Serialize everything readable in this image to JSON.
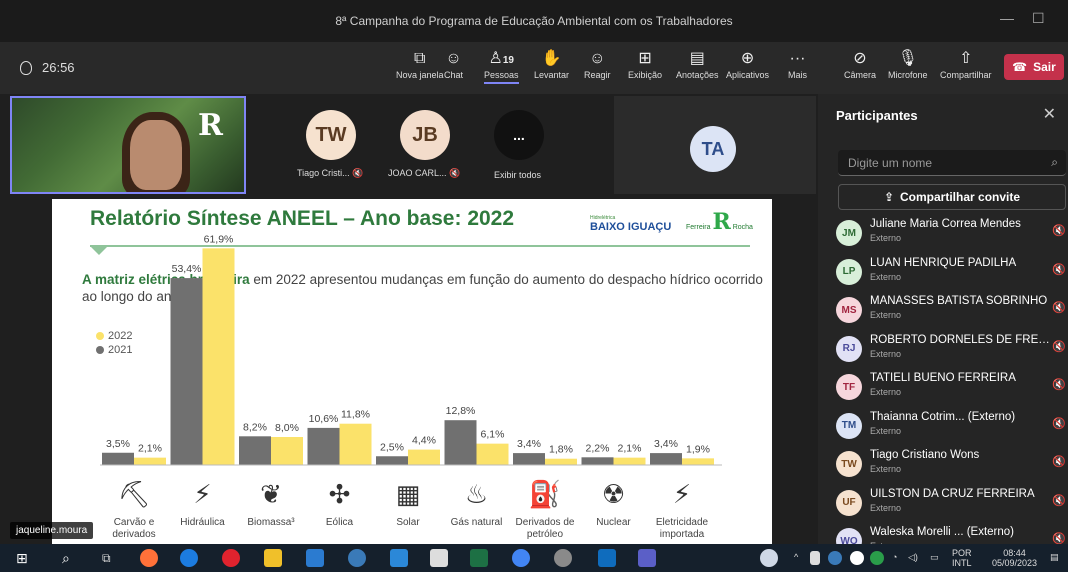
{
  "window": {
    "title": "8ª Campanha do Programa de Educação Ambiental com os Trabalhadores",
    "minimize": "—",
    "maximize": "☐"
  },
  "toolbar": {
    "timer": "26:56",
    "buttons": [
      {
        "label": "Nova janela",
        "icon": "new-window-icon"
      },
      {
        "label": "Chat",
        "icon": "chat-icon"
      },
      {
        "label": "Pessoas",
        "icon": "people-icon",
        "count": "19"
      },
      {
        "label": "Levantar",
        "icon": "raise-hand-icon"
      },
      {
        "label": "Reagir",
        "icon": "react-icon"
      },
      {
        "label": "Exibição",
        "icon": "view-icon"
      },
      {
        "label": "Anotações",
        "icon": "notes-icon"
      },
      {
        "label": "Aplicativos",
        "icon": "apps-icon"
      },
      {
        "label": "Mais",
        "icon": "more-icon"
      },
      {
        "label": "Câmera",
        "icon": "camera-off-icon"
      },
      {
        "label": "Microfone",
        "icon": "mic-off-icon"
      },
      {
        "label": "Compartilhar",
        "icon": "share-icon"
      }
    ],
    "leave_label": "Sair"
  },
  "stage": {
    "presenter_logo": "R",
    "tiles": [
      {
        "initials": "TW",
        "name": "Tiago Cristi...",
        "color": "#f6e2cf"
      },
      {
        "initials": "JB",
        "name": "JOAO CARL...",
        "color": "#f3dccb"
      },
      {
        "initials": "...",
        "name": "Exibir todos",
        "color": "#111111"
      }
    ],
    "large_tile_initials": "TA",
    "presenter_name": "jaqueline.moura"
  },
  "slide": {
    "title": "Relatório Síntese ANEEL – Ano base: 2022",
    "brand_small": "Hidrelétrica",
    "brand_main": "BAIXO IGUAÇU",
    "brand2_left": "Ferreira",
    "brand2_right": "Rocha",
    "brand2_letter": "R",
    "text_bold": "A matriz elétrica brasileira",
    "text_rest": " em 2022 apresentou mudanças em função do aumento do despacho hídrico ocorrido ao longo do ano.",
    "chart_data": {
      "type": "bar",
      "categories": [
        "Carvão e derivados",
        "Hidráulica",
        "Biomassa³",
        "Eólica",
        "Solar",
        "Gás natural",
        "Derivados de petróleo",
        "Nuclear",
        "Eletricidade importada"
      ],
      "series": [
        {
          "name": "2021",
          "color": "#707070",
          "values": [
            3.5,
            53.4,
            8.2,
            10.6,
            2.5,
            12.8,
            3.4,
            2.2,
            3.4
          ],
          "labels": [
            "3,5%",
            "53,4%",
            "8,2%",
            "10,6%",
            "2,5%",
            "12,8%",
            "3,4%",
            "2,2%",
            "3,4%"
          ]
        },
        {
          "name": "2022",
          "color": "#fbe26a",
          "values": [
            2.1,
            61.9,
            8.0,
            11.8,
            4.4,
            6.1,
            1.8,
            2.1,
            1.9
          ],
          "labels": [
            "2,1%",
            "61,9%",
            "8,0%",
            "11,8%",
            "4,4%",
            "6,1%",
            "1,8%",
            "2,1%",
            "1,9%"
          ]
        }
      ],
      "icons": [
        "coal-cart-icon",
        "hydro-icon",
        "biomass-icon",
        "wind-turbine-icon",
        "solar-panel-icon",
        "gas-flame-icon",
        "oil-rig-icon",
        "nuclear-plant-icon",
        "power-tower-icon"
      ],
      "icon_glyphs": [
        "⛏",
        "⚡",
        "❦",
        "✣",
        "▦",
        "♨",
        "⛽",
        "☢",
        "⚡"
      ]
    }
  },
  "panel": {
    "title": "Participantes",
    "search_placeholder": "Digite um nome",
    "invite_label": "Compartilhar convite",
    "participants": [
      {
        "initials": "JM",
        "name": "Juliane Maria Correa Mendes",
        "sub": "Externo",
        "color": "#d8efd9",
        "fg": "#2d6a34"
      },
      {
        "initials": "LP",
        "name": "LUAN HENRIQUE PADILHA",
        "sub": "Externo",
        "color": "#d8efd9",
        "fg": "#2d6a34"
      },
      {
        "initials": "MS",
        "name": "MANASSES BATISTA SOBRINHO",
        "sub": "Externo",
        "color": "#f6d6dc",
        "fg": "#a1243f"
      },
      {
        "initials": "RJ",
        "name": "ROBERTO DORNELES DE FREITA...",
        "sub": "Externo",
        "color": "#e1e1f5",
        "fg": "#4a4a9a"
      },
      {
        "initials": "TF",
        "name": "TATIELI BUENO FERREIRA",
        "sub": "Externo",
        "color": "#f6d6dc",
        "fg": "#a1243f"
      },
      {
        "initials": "TM",
        "name": "Thaianna Cotrim... (Externo)",
        "sub": "Externo",
        "color": "#dce4f5",
        "fg": "#2e4d8a"
      },
      {
        "initials": "TW",
        "name": "Tiago Cristiano Wons",
        "sub": "Externo",
        "color": "#f6e2cf",
        "fg": "#7a4a1f"
      },
      {
        "initials": "UF",
        "name": "UILSTON DA CRUZ FERREIRA",
        "sub": "Externo",
        "color": "#f6e2cf",
        "fg": "#7a4a1f"
      },
      {
        "initials": "WO",
        "name": "Waleska Morelli ... (Externo)",
        "sub": "Externo",
        "color": "#e1e1f5",
        "fg": "#4a4a9a"
      }
    ]
  },
  "taskbar": {
    "lang": "POR",
    "lang_sub": "INTL",
    "time": "08:44",
    "date": "05/09/2023"
  }
}
